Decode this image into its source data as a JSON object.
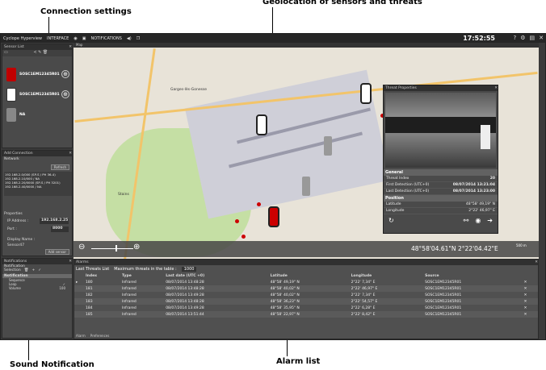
{
  "callouts": {
    "connection": "Connection settings",
    "geolocation": "Geolocation of sensors and threats",
    "sound": "Sound Notification",
    "alarm": "Alarm list"
  },
  "topbar": {
    "app_name": "Cyclope Hyperview",
    "interface": "INTERFACE",
    "notifications": "NOTIFICATIONS",
    "clock": "17:52:55"
  },
  "sensor_list": {
    "title": "Sensor List",
    "sensors": [
      {
        "label": "SOSC1EM12345R01",
        "color": "#c00000"
      },
      {
        "label": "SOSC1EM12345R01",
        "color": "#ffffff"
      },
      {
        "label": "NA",
        "color": "#888888"
      }
    ]
  },
  "add_connection": {
    "title": "Add Connection",
    "network": "Network",
    "refresh": "Refresh",
    "networks": [
      "192.168.2.0/000 (SP-S / PH 36-4)",
      "192.168.2.10/000 / NA",
      "192.168.2.20/0000 (SP-S / PH 3201)",
      "192.168.2.40/0000 / NA"
    ],
    "properties": "Properties",
    "ip_label": "IP Address :",
    "ip_value": "192.168.2.25",
    "port_label": "Port :",
    "port_value": "8000",
    "display_label": "Display Name :",
    "display_value": "Sensor47",
    "add_button": "Add sensor"
  },
  "notifications": {
    "title": "Notifications",
    "subtitle": "Notification",
    "selection": "Selection",
    "header": "Notification",
    "items": [
      {
        "label": "Sequence",
        "value": ""
      },
      {
        "label": "Loop",
        "value": "✓"
      },
      {
        "label": "Volume",
        "value": "100"
      }
    ]
  },
  "map": {
    "tab": "Map",
    "lat": "48°58'04.61\"N",
    "lon": "2°22'04.42\"E",
    "scale": "500 m",
    "places": [
      "Garges-lès-Gonesse",
      "Stains"
    ]
  },
  "threat": {
    "title": "Threat Properties",
    "general": "General",
    "fields": [
      {
        "label": "Threat Index",
        "value": "20"
      },
      {
        "label": "First Detection (UTC+0)",
        "value": "08/07/2014 13:21:04"
      },
      {
        "label": "Last Detection (UTC+0)",
        "value": "08/07/2014 13:23:00"
      }
    ],
    "position": "Position",
    "pos_fields": [
      {
        "label": "Latitude",
        "value": "48°58' 49,19\" N"
      },
      {
        "label": "Longitude",
        "value": "2°22' 46,97\" E"
      }
    ]
  },
  "alarms": {
    "title": "Alarms",
    "tab": "Last Threats List",
    "max_label": "Maximum threats in the table :",
    "max_value": "1000",
    "columns": [
      "Index",
      "Type",
      "Last date (UTC +0)",
      "Latitude",
      "Longitude",
      "Source"
    ],
    "rows": [
      [
        "180",
        "Infrared",
        "08/07/2014 13:48:28",
        "48°58' 49,19\" N",
        "2°22' 7,34\" E",
        "SOSC1EM12345R01"
      ],
      [
        "181",
        "Infrared",
        "08/07/2014 13:48:28",
        "48°58' 40,02\" N",
        "2°22' 46,97\" E",
        "SOSC1EM12345R01"
      ],
      [
        "182",
        "Infrared",
        "08/07/2014 13:49:28",
        "48°58' 40,02\" N",
        "2°22' 7,34\" E",
        "SOSC1EM12345R01"
      ],
      [
        "183",
        "Infrared",
        "08/07/2014 13:48:28",
        "48°58' 36,23\" N",
        "2°22' 54,57\" E",
        "SOSC1EM12345R01"
      ],
      [
        "184",
        "Infrared",
        "08/07/2014 13:49:28",
        "48°58' 35,95\" N",
        "2°22' 6,28\" E",
        "SOSC1EM12345R01"
      ],
      [
        "185",
        "Infrared",
        "08/07/2014 13:51:44",
        "48°58' 22,97\" N",
        "2°22' 8,42\" E",
        "SOSC1EM12345R01"
      ]
    ],
    "bottom_tabs": [
      "Alarm",
      "Preferences"
    ]
  }
}
